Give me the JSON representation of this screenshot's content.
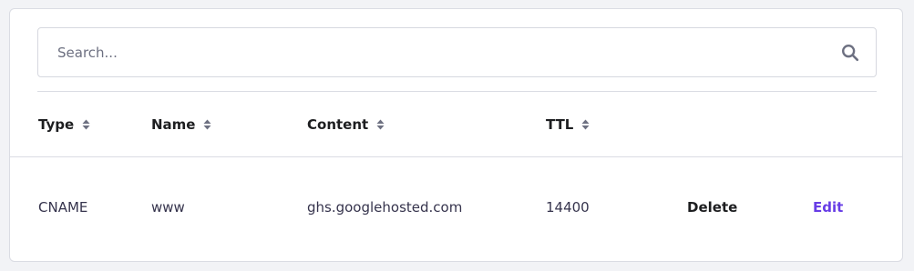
{
  "search": {
    "placeholder": "Search...",
    "value": ""
  },
  "table": {
    "columns": [
      {
        "label": "Type",
        "sortable": true
      },
      {
        "label": "Name",
        "sortable": true
      },
      {
        "label": "Content",
        "sortable": true
      },
      {
        "label": "TTL",
        "sortable": true
      }
    ],
    "rows": [
      {
        "type": "CNAME",
        "name": "www",
        "content": "ghs.googlehosted.com",
        "ttl": "14400",
        "delete_label": "Delete",
        "edit_label": "Edit"
      }
    ]
  },
  "colors": {
    "accent": "#673de6",
    "text": "#1d1e20",
    "border": "#dadce3",
    "background": "#f2f3f6"
  },
  "icons": {
    "search": "search-icon",
    "sort": "sort-icon"
  }
}
